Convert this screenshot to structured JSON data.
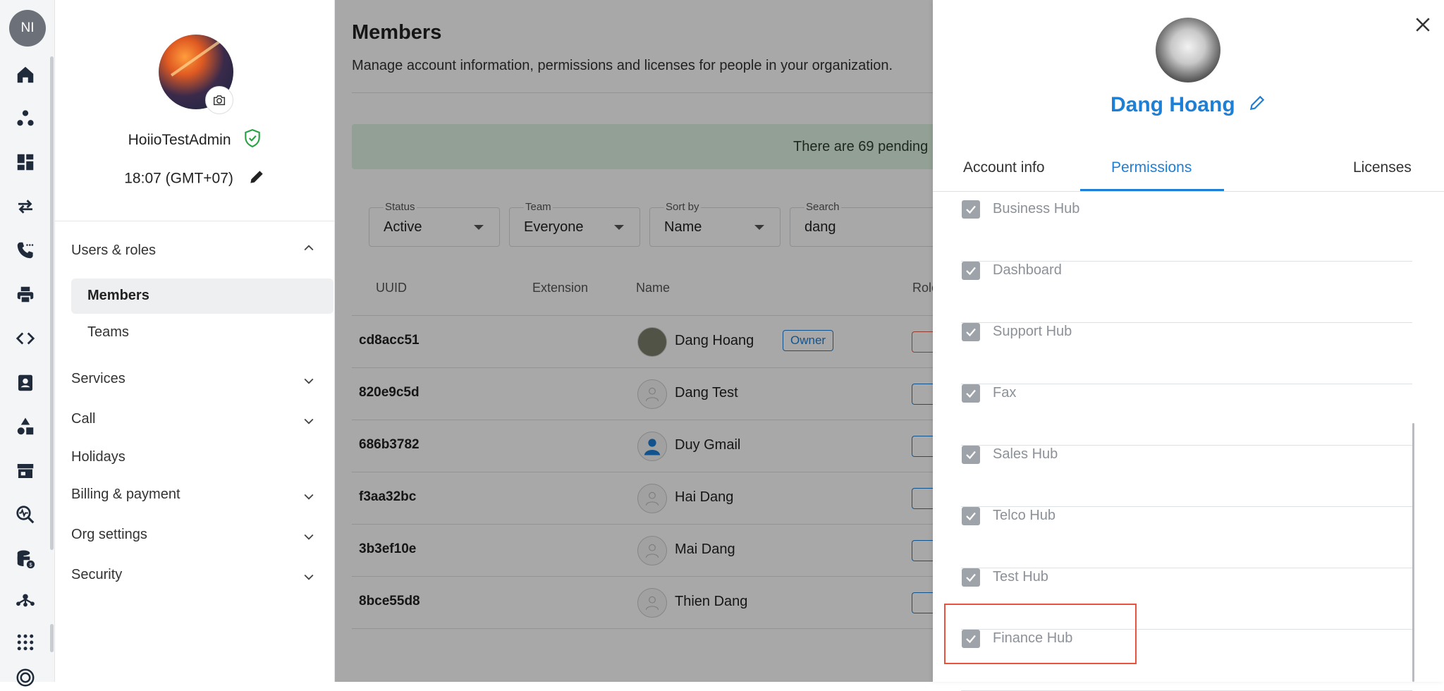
{
  "rail": {
    "avatar_initials": "NI",
    "icons": [
      "home-icon",
      "org-icon",
      "dashboard-icon",
      "transfer-icon",
      "phone-icon",
      "printer-icon",
      "code-icon",
      "contacts-icon",
      "shapes-icon",
      "store-icon",
      "monitor-search-icon",
      "database-dollar-icon",
      "network-icon",
      "apps-grid-icon",
      "radar-icon"
    ]
  },
  "sidebar": {
    "username": "HoiioTestAdmin",
    "time": "18:07 (GMT+07)",
    "sections": {
      "users_roles": "Users & roles",
      "members": "Members",
      "teams": "Teams",
      "services": "Services",
      "call": "Call",
      "holidays": "Holidays",
      "billing": "Billing & payment",
      "org_settings": "Org settings",
      "security": "Security"
    }
  },
  "main": {
    "title": "Members",
    "description": "Manage account information, permissions and licenses for people in your organization.",
    "banner": "There are 69 pending",
    "filters": {
      "status": {
        "label": "Status",
        "value": "Active"
      },
      "team": {
        "label": "Team",
        "value": "Everyone"
      },
      "sort": {
        "label": "Sort by",
        "value": "Name"
      },
      "search": {
        "label": "Search",
        "value": "dang"
      }
    },
    "columns": {
      "uuid": "UUID",
      "extension": "Extension",
      "name": "Name",
      "role": "Role"
    },
    "rows": [
      {
        "uuid": "cd8acc51",
        "name": "Dang Hoang",
        "badge": "Owner"
      },
      {
        "uuid": "820e9c5d",
        "name": "Dang Test"
      },
      {
        "uuid": "686b3782",
        "name": "Duy Gmail"
      },
      {
        "uuid": "f3aa32bc",
        "name": "Hai Dang"
      },
      {
        "uuid": "3b3ef10e",
        "name": "Mai Dang"
      },
      {
        "uuid": "8bce55d8",
        "name": "Thien Dang"
      }
    ]
  },
  "panel": {
    "name": "Dang Hoang",
    "tabs": {
      "account": "Account info",
      "permissions": "Permissions",
      "licenses": "Licenses"
    },
    "permissions": [
      {
        "label": "Business Hub",
        "checked": true
      },
      {
        "label": "Dashboard",
        "checked": true
      },
      {
        "label": "Support Hub",
        "checked": true
      },
      {
        "label": "Fax",
        "checked": true
      },
      {
        "label": "Sales Hub",
        "checked": true
      },
      {
        "label": "Telco Hub",
        "checked": true
      },
      {
        "label": "Test Hub",
        "checked": true
      },
      {
        "label": "Finance Hub",
        "checked": true
      }
    ]
  },
  "colors": {
    "accent": "#1e7fd6",
    "highlight": "#e8533f",
    "banner_bg": "#dff3e2"
  }
}
